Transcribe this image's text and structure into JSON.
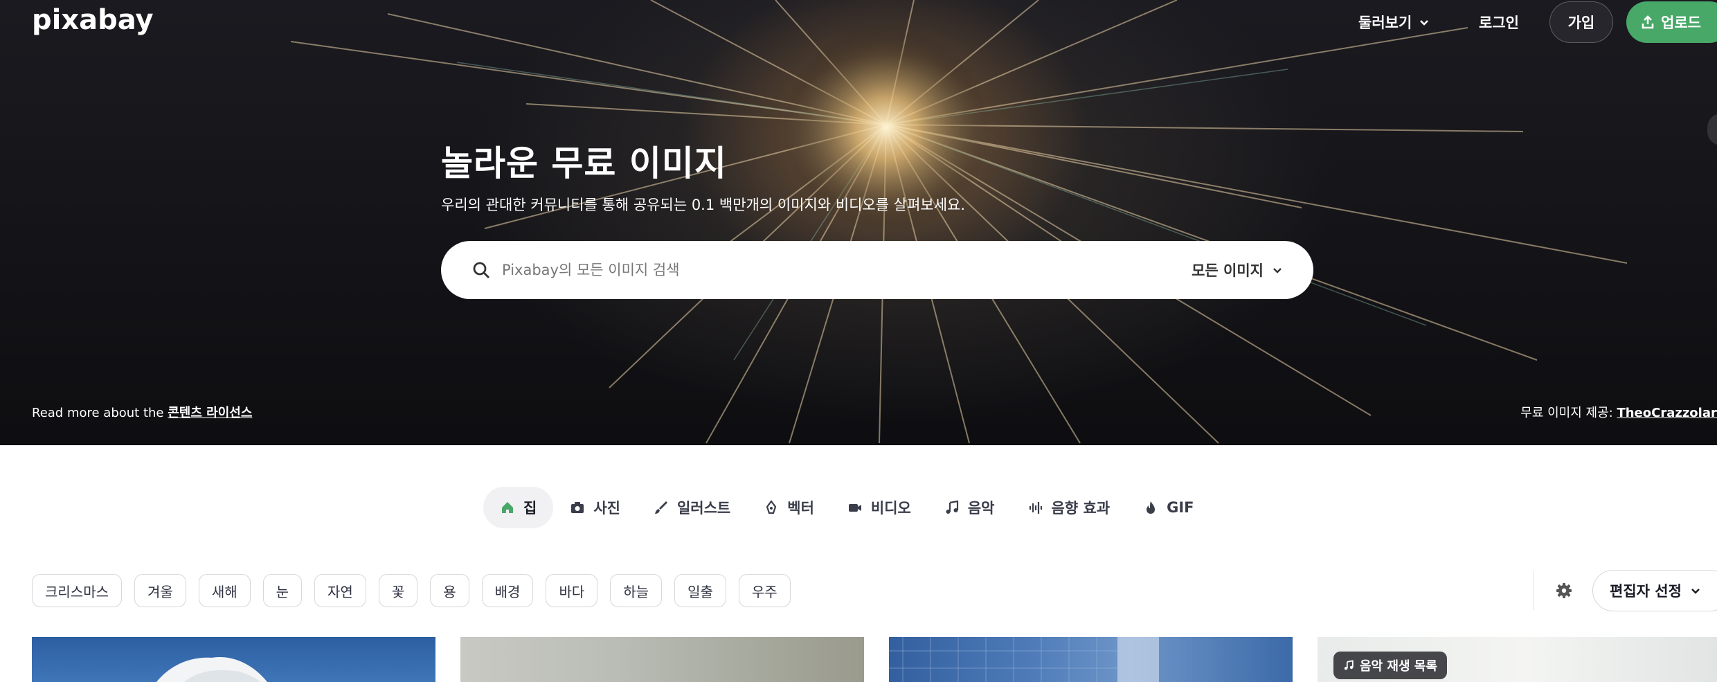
{
  "header": {
    "logo_text": "pixabay",
    "explore_label": "둘러보기",
    "login_label": "로그인",
    "join_label": "가입",
    "upload_label": "업로드"
  },
  "hero": {
    "title": "놀라운 무료 이미지",
    "subtitle": "우리의 관대한 커뮤니티를 통해 공유되는 0.1 백만개의 이미지와 비디오를 살펴보세요.",
    "license_prefix": "Read more about the ",
    "license_link": "콘텐츠 라이선스",
    "credit_prefix": "무료 이미지 제공: ",
    "credit_user": "TheoCrazzolara"
  },
  "search": {
    "placeholder": "Pixabay의 모든 이미지 검색",
    "scope_label": "모든 이미지"
  },
  "tabs": [
    {
      "label": "집",
      "icon": "home-icon"
    },
    {
      "label": "사진",
      "icon": "camera-icon"
    },
    {
      "label": "일러스트",
      "icon": "brush-icon"
    },
    {
      "label": "벡터",
      "icon": "pen-nib-icon"
    },
    {
      "label": "비디오",
      "icon": "video-icon"
    },
    {
      "label": "음악",
      "icon": "music-note-icon"
    },
    {
      "label": "음향 효과",
      "icon": "sound-wave-icon"
    },
    {
      "label": "GIF",
      "icon": "flame-icon"
    }
  ],
  "chips": [
    "크리스마스",
    "겨울",
    "새해",
    "눈",
    "자연",
    "꽃",
    "용",
    "배경",
    "바다",
    "하늘",
    "일출",
    "우주"
  ],
  "sort": {
    "label": "편집자 선정"
  },
  "grid": {
    "playlist_badge": "음악 재생 목록"
  },
  "colors": {
    "accent_green": "#48a868",
    "text_dark": "#191b26"
  }
}
